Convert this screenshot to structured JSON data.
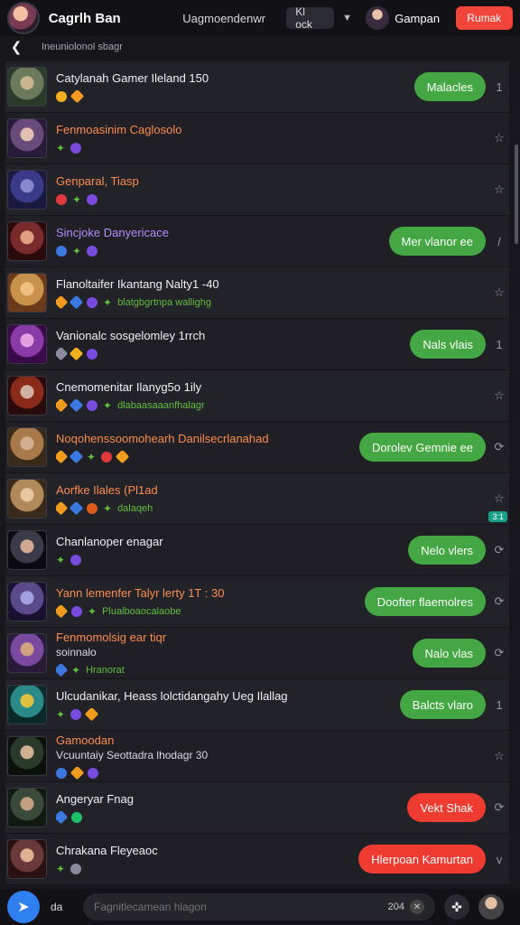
{
  "header": {
    "brand": "Cagrlh Ban",
    "filter_label": "Uagmoendenwr",
    "sort_label": "Kl ock",
    "user_name": "Gampan",
    "cta_label": "Rumak"
  },
  "subheader": {
    "breadcrumb": "Ineuniolonol sbagr"
  },
  "rows": [
    {
      "title": "Catylanah Gamer Ileland 150",
      "title_color": "#f2f2f4",
      "action": "Malacles",
      "action_color": "green",
      "trail": "1",
      "badges": "",
      "avatar": [
        "#6b7a5a",
        "#2b3b2a",
        "#c8b48c"
      ]
    },
    {
      "title": "Fenmoasinim Caglosolo",
      "title_color": "#ff8c4a",
      "action": "",
      "action_color": "",
      "trail": "☆",
      "badges": "",
      "avatar": [
        "#6a4a7a",
        "#2a1a3a",
        "#e0c0b0"
      ]
    },
    {
      "title": "Genparal, Tiasp",
      "title_color": "#ff8c4a",
      "action": "",
      "action_color": "",
      "trail": "☆",
      "badges": "",
      "avatar": [
        "#3a3a8a",
        "#1a1a40",
        "#8888cc"
      ]
    },
    {
      "title": "Sincjoke Danyericace",
      "title_color": "#b58cff",
      "action": "Mer vlanor ee",
      "action_color": "green",
      "trail": "/",
      "badges": "",
      "avatar": [
        "#7a2a2a",
        "#2a0a0a",
        "#e0a080"
      ]
    },
    {
      "title": "Flanoltaifer Ikantang Nalty1 -40",
      "title_color": "#f2f2f4",
      "action": "",
      "action_color": "",
      "trail": "☆",
      "badges": "blatgbgrtnpa wallighg",
      "avatar": [
        "#c8924a",
        "#6a3a1a",
        "#f0c080"
      ]
    },
    {
      "title": "Vanionalc sosgelomley 1rrch",
      "title_color": "#f2f2f4",
      "action": "Nals vlais",
      "action_color": "green",
      "trail": "1",
      "badges": "",
      "avatar": [
        "#8a3aa8",
        "#3a0a4a",
        "#e0a0e0"
      ]
    },
    {
      "title": "Cnemomenitar Ilanyg5o 1ily",
      "title_color": "#f2f2f4",
      "action": "",
      "action_color": "",
      "trail": "☆",
      "badges": "dlabaasaaanfhalagr",
      "avatar": [
        "#8a2a1a",
        "#2a0a0a",
        "#d0b0a0"
      ]
    },
    {
      "title": "Noqohenssoomohearh Danilsecrlanahad",
      "title_color": "#ff8c4a",
      "action": "Dorolev Gemnie ee",
      "action_color": "green",
      "trail": "⟳",
      "badges": "",
      "avatar": [
        "#a87a4a",
        "#3a2a1a",
        "#d0b090"
      ]
    },
    {
      "title": "Aorfke Ilales (Pl1ad",
      "title_color": "#ff8c4a",
      "action": "",
      "action_color": "",
      "trail": "☆",
      "badges": "dalaqeh",
      "avatar": [
        "#b08a5a",
        "#3a2a1a",
        "#e8c8a0"
      ],
      "mini": "3:1"
    },
    {
      "title": "Chanlanoper enagar",
      "title_color": "#f2f2f4",
      "action": "Nelo vlers",
      "action_color": "green",
      "trail": "⟳",
      "badges": "",
      "avatar": [
        "#3a3a4a",
        "#0a0a10",
        "#d0a890"
      ]
    },
    {
      "title": "Yann lemenfer Talyr lerty 1T : 30",
      "title_color": "#ff8c4a",
      "action": "Doofter flaemolres",
      "action_color": "green",
      "trail": "⟳",
      "badges": "Plualboaocalaobe",
      "avatar": [
        "#5a4a8a",
        "#1a1030",
        "#a0a0e0"
      ]
    },
    {
      "title": "Fenmomolsig ear tiqr",
      "title_color": "#ff8c4a",
      "action": "Nalo vlas",
      "action_color": "green",
      "trail": "⟳",
      "badges": "Hranorat",
      "avatar": [
        "#7a4aa0",
        "#2a1a3a",
        "#d0a080"
      ],
      "sub": "soinnalo"
    },
    {
      "title": "Ulcudanikar, Heass  lolctidangahy Ueg Ilallag",
      "title_color": "#f2f2f4",
      "action": "Balcts vlaro",
      "action_color": "green",
      "trail": "1",
      "badges": "",
      "avatar": [
        "#2a8a8a",
        "#0a2a2a",
        "#e0c040"
      ]
    },
    {
      "title": "Gamoodan",
      "title_color": "#ff8c4a",
      "action": "",
      "action_color": "",
      "trail": "☆",
      "badges": "",
      "avatar": [
        "#2a3a2a",
        "#0a100a",
        "#d0b090"
      ],
      "sub": "Vcuuntaiy Seottadra lhodagr 30"
    },
    {
      "title": "Angeryar Fnag",
      "title_color": "#f2f2f4",
      "action": "Vekt Shak",
      "action_color": "red",
      "trail": "⟳",
      "badges": "",
      "avatar": [
        "#3a4a3a",
        "#101a10",
        "#c0a080"
      ]
    },
    {
      "title": "Chrakana Fleyeaoc",
      "title_color": "#f2f2f4",
      "action": "Hlerpoan Kamurtan",
      "action_color": "red",
      "trail": "v",
      "badges": "",
      "avatar": [
        "#6a3a3a",
        "#2a1010",
        "#e0b090"
      ]
    }
  ],
  "bottom": {
    "lang_label": "da",
    "composer_placeholder": "Fagnitlecamean hlagon",
    "composer_count": "204"
  },
  "colors": {
    "accent_green": "#43a843",
    "accent_red": "#ef3b30",
    "accent_blue": "#2f7ff0",
    "title_orange": "#ff8c4a",
    "title_purple": "#b58cff"
  }
}
